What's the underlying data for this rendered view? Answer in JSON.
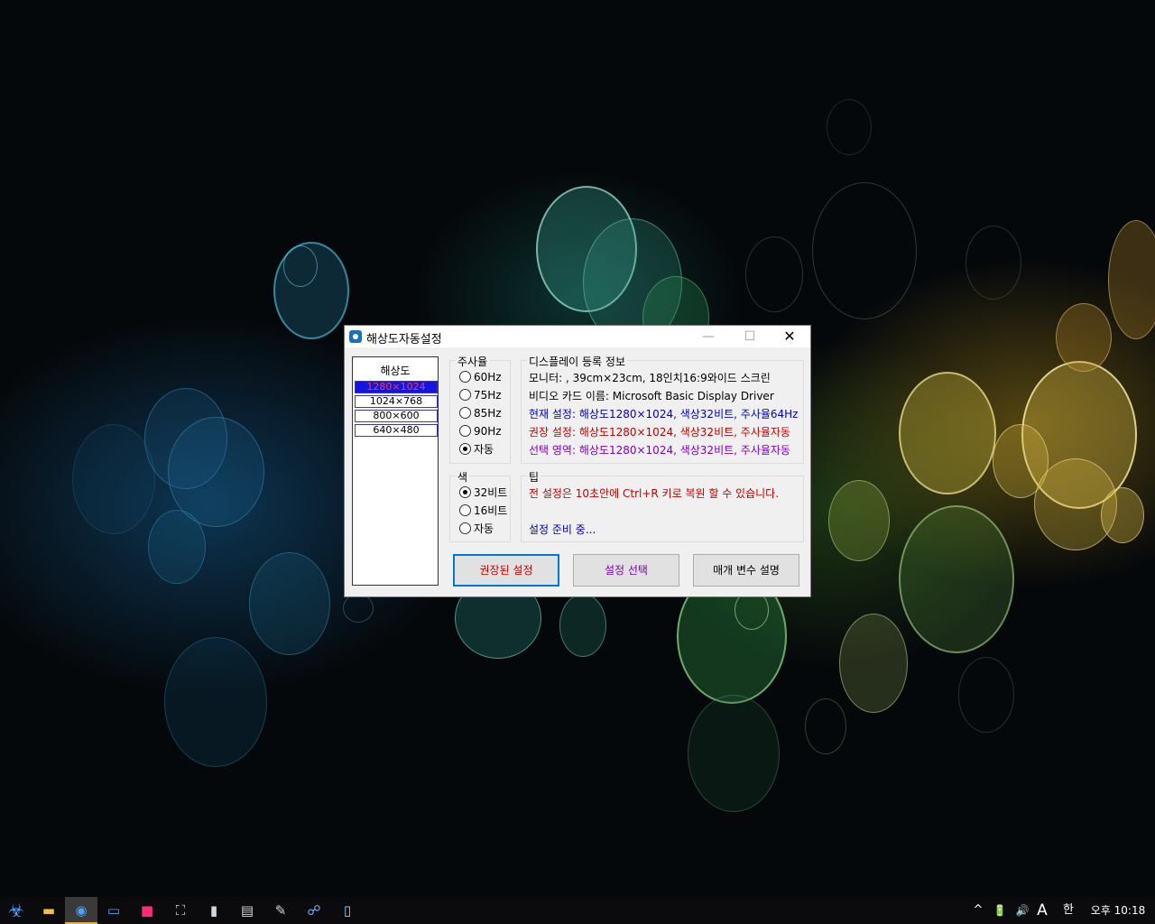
{
  "window": {
    "title": "해상도자동설정",
    "minimize": "—",
    "maximize": "☐",
    "close": "✕"
  },
  "resolution_list": {
    "title": "해상도",
    "items": [
      "1280×1024",
      "1024×768",
      "800×600",
      "640×480"
    ],
    "selected_index": 0
  },
  "refresh_rate": {
    "label": "주사율",
    "options": [
      "60Hz",
      "75Hz",
      "85Hz",
      "90Hz",
      "자동"
    ],
    "selected": "자동"
  },
  "color_depth": {
    "label": "색",
    "options": [
      "32비트",
      "16비트",
      "자동"
    ],
    "selected": "32비트"
  },
  "display_info": {
    "label": "디스플레이 등록 정보",
    "monitor": "모니터: , 39cm×23cm, 18인치16:9와이드 스크린",
    "video_card": "비디오 카드 이름: Microsoft Basic Display Driver",
    "current": "현재 설정: 해상도1280×1024, 색상32비트, 주사율64Hz",
    "recommended": "권장 설정: 해상도1280×1024, 색상32비트, 주사율자동",
    "selection": "선택 영역: 해상도1280×1024, 색상32비트, 주사율자동"
  },
  "tip": {
    "label": "팁",
    "message": "전 설정은 10초안에 Ctrl+R 키로 복원 할 수 있습니다.",
    "status": "설정 준비 중..."
  },
  "buttons": {
    "recommended": "권장된 설정",
    "select": "설정 선택",
    "params": "매개 변수 설명"
  },
  "colors": {
    "current_text": "#0000c0",
    "recommended_text": "#c00000",
    "selection_text": "#8000c0",
    "tip_text": "#c00000",
    "status_text": "#0000c0",
    "selected_item_bg": "#1515e0",
    "focus_border": "#0078d7"
  },
  "taskbar": {
    "icons": [
      "biohazard-icon",
      "folder-icon",
      "resolution-app-icon",
      "monitor-icon",
      "app-red-icon",
      "screen-select-icon",
      "usb-drive-icon",
      "printer-icon",
      "tool-icon",
      "network-icon",
      "file-icon"
    ],
    "tray": {
      "chevron": "^",
      "battery": "🔋",
      "volume": "🔊",
      "font": "A",
      "ime": "한",
      "clock": "오후 10:18"
    }
  }
}
